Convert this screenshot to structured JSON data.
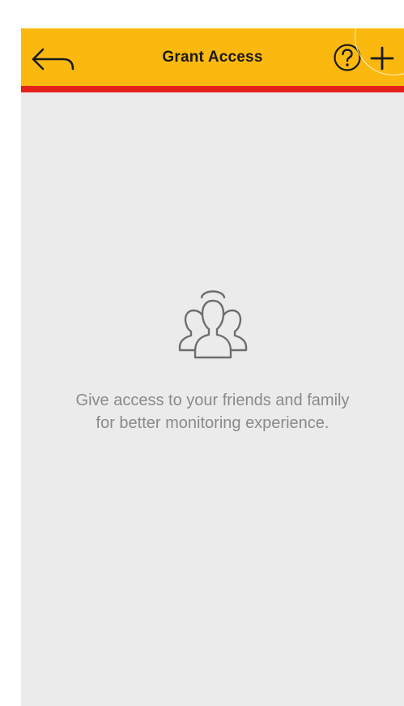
{
  "app_bar": {
    "title": "Grant Access",
    "background_color": "#fbb80f",
    "stripe_color": "#e5201b",
    "back_icon": "back-arrow-icon",
    "help_icon": "help-circle-icon",
    "add_icon": "plus-icon"
  },
  "empty_state": {
    "icon": "people-group-icon",
    "message": "Give access to your friends and family\nfor better monitoring experience."
  },
  "colors": {
    "content_background": "#ebebeb",
    "message_text": "#8a8a8a"
  }
}
